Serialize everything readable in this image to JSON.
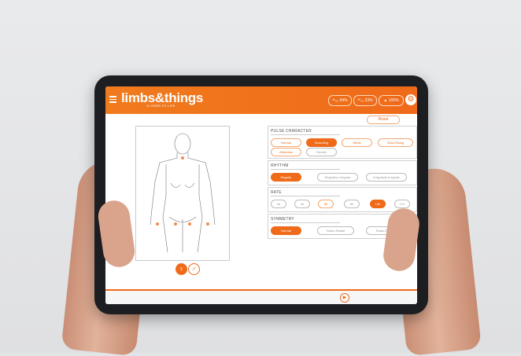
{
  "header": {
    "logo": "limbs&things",
    "tagline": "CLOSER TO LIFE",
    "stats": [
      "²⁵₀₂ 94%",
      "²⁰₀₂ 23%",
      "100%"
    ]
  },
  "reset_label": "Reset",
  "sections": {
    "pulse": {
      "title": "PULSE CHARACTER",
      "options": [
        "Normal",
        "Bounding",
        "Weak",
        "Slow-Rising",
        "Alternans",
        "Dicrotic"
      ],
      "selected": "Bounding"
    },
    "rhythm": {
      "title": "RHYTHM",
      "options": [
        "Regular",
        "Regularly Irregular",
        "Irregularly Irregular"
      ],
      "selected": "Regular"
    },
    "rate": {
      "title": "RATE",
      "options": [
        "30",
        "40",
        "60",
        "80",
        "100",
        "170"
      ],
      "selected": "100"
    },
    "symmetry": {
      "title": "SYMMETRY",
      "options": [
        "Normal",
        "Radio-Radial",
        "Radio-Femoral"
      ],
      "selected": "Normal"
    }
  },
  "gender": {
    "female": "♀",
    "male": "♂"
  },
  "colors": {
    "accent": "#ef6a19",
    "bezel": "#1d1e21"
  }
}
